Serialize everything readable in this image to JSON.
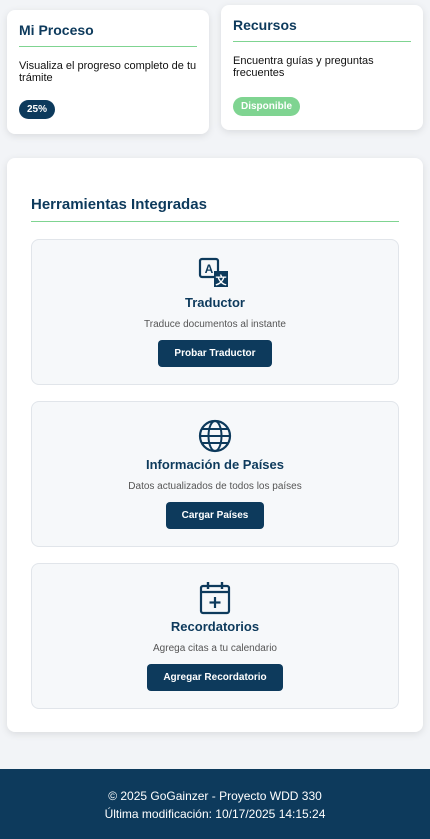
{
  "proceso": {
    "title": "Mi Proceso",
    "description": "Visualiza el progreso completo de tu trámite",
    "progress_label": "25%",
    "progress": 0.25
  },
  "recursos": {
    "title": "Recursos",
    "description": "Encuentra guías y preguntas frecuentes",
    "status": "Disponible"
  },
  "tools": {
    "title": "Herramientas Integradas",
    "items": [
      {
        "icon": "translate-icon",
        "name": "Traductor",
        "description": "Traduce documentos al instante",
        "button": "Probar Traductor"
      },
      {
        "icon": "globe-icon",
        "name": "Información de Países",
        "description": "Datos actualizados de todos los países",
        "button": "Cargar Países"
      },
      {
        "icon": "calendar-icon",
        "name": "Recordatorios",
        "description": "Agrega citas a tu calendario",
        "button": "Agregar Recordatorio"
      }
    ]
  },
  "footer": {
    "copyright": "© 2025 GoGainzer - Proyecto WDD 330",
    "last_modified": "Última modificación: 10/17/2025 14:15:24"
  },
  "colors": {
    "primary": "#0d3a5c",
    "accent": "#7fd491",
    "background": "#f2f4f7"
  }
}
